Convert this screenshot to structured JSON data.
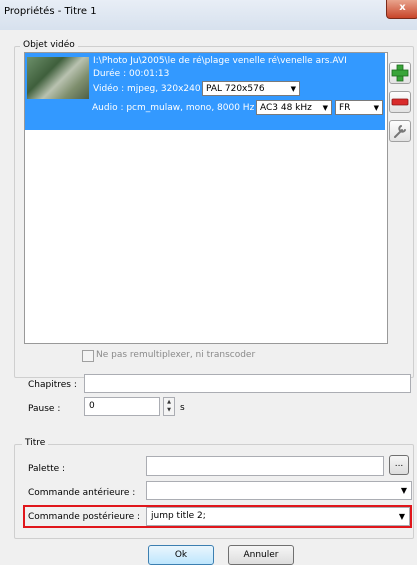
{
  "window": {
    "title": "Propriétés - Titre 1",
    "close_label": "x"
  },
  "video_group": {
    "label": "Objet vidéo",
    "item": {
      "path": "I:\\Photo Ju\\2005\\le de ré\\plage venelle ré\\venelle ars.AVI",
      "duration": "Durée : 00:01:13",
      "video_info": "Vidéo : mjpeg, 320x240",
      "video_format": "PAL 720x576",
      "audio_info": "Audio : pcm_mulaw, mono, 8000 Hz",
      "audio_format": "AC3 48 kHz",
      "audio_lang": "FR"
    },
    "no_remux_label": "Ne pas remultiplexer, ni transcoder",
    "no_remux_checked": false
  },
  "chapters": {
    "label": "Chapitres :",
    "value": ""
  },
  "pause": {
    "label": "Pause :",
    "value": "0",
    "unit": "s"
  },
  "title_group": {
    "label": "Titre",
    "palette": {
      "label": "Palette :",
      "value": "",
      "browse_label": "..."
    },
    "pre_command": {
      "label": "Commande antérieure :",
      "value": ""
    },
    "post_command": {
      "label": "Commande postérieure :",
      "value": "jump title 2;"
    }
  },
  "buttons": {
    "ok": "Ok",
    "cancel": "Annuler"
  },
  "colors": {
    "selection": "#3399ff",
    "highlight": "#e0161b",
    "add": "#3aa53a",
    "remove": "#d92b2b"
  }
}
